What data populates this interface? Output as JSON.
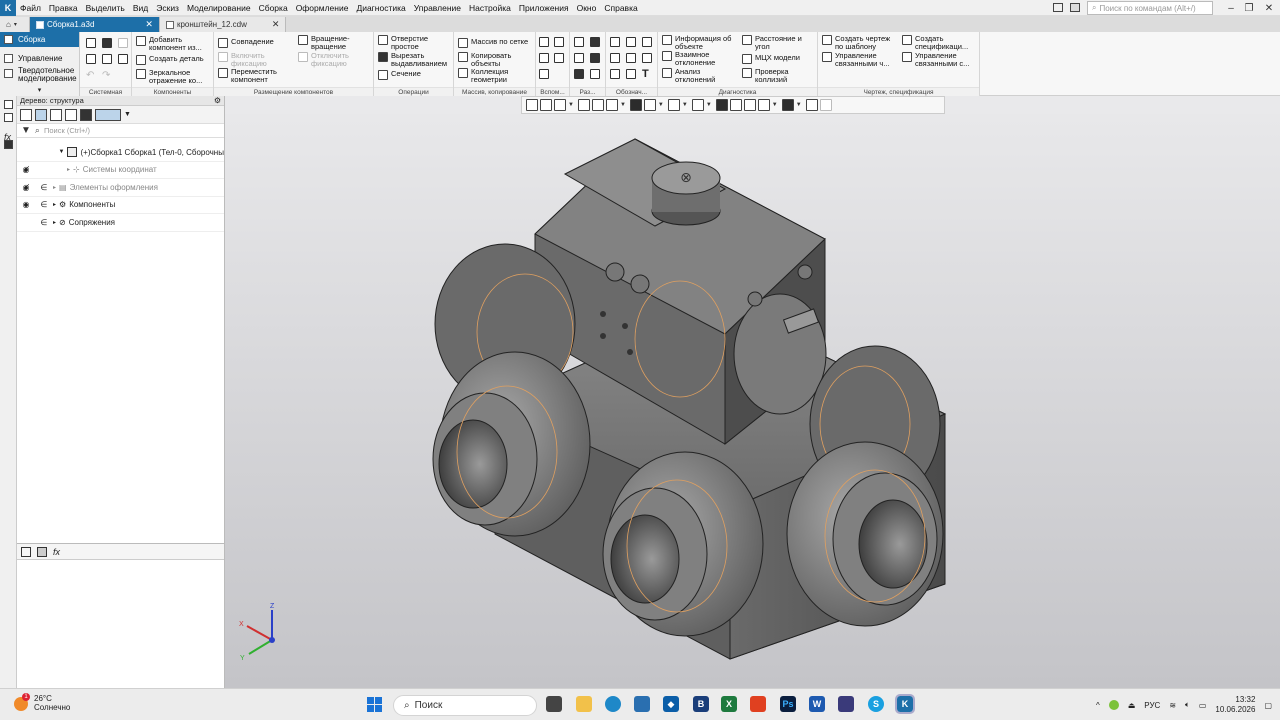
{
  "menubar": {
    "items": [
      "Файл",
      "Правка",
      "Выделить",
      "Вид",
      "Эскиз",
      "Моделирование",
      "Сборка",
      "Оформление",
      "Диагностика",
      "Управление",
      "Настройка",
      "Приложения",
      "Окно",
      "Справка"
    ],
    "search_placeholder": "Поиск по командам (Alt+/)"
  },
  "tabs": [
    {
      "label": "Сборка1.a3d",
      "active": true
    },
    {
      "label": "кронштейн_12.cdw",
      "active": false
    }
  ],
  "leftnav": {
    "items": [
      "Сборка",
      "Управление",
      "Твердотельное моделирование"
    ]
  },
  "ribbon": {
    "groups": [
      "Системная",
      "Компоненты",
      "Размещение компонентов",
      "Операции",
      "Массив, копирование",
      "Вспом...",
      "Раз...",
      "Обознач...",
      "Диагностика",
      "Чертеж, спецификация"
    ],
    "components": {
      "add": "Добавить компонент из...",
      "create_part": "Создать деталь",
      "mirror": "Зеркальное отражение ко..."
    },
    "placement": {
      "coincide": "Совпадение",
      "enable_fix": "Включить фиксацию",
      "move": "Переместить компонент",
      "rotate": "Вращение-вращение",
      "disable_fix": "Отключить фиксацию"
    },
    "operations": {
      "hole": "Отверстие простое",
      "cut": "Вырезать выдавливанием",
      "section": "Сечение"
    },
    "array": {
      "grid": "Массив по сетке",
      "copy": "Копировать объекты",
      "collection": "Коллекция геометрии"
    },
    "diagnostics": {
      "info": "Информация об объекте",
      "deviation": "Взаимное отклонение",
      "analysis": "Анализ отклонений",
      "distance": "Расстояние и угол",
      "mass": "МЦХ модели",
      "collision": "Проверка коллизий"
    },
    "drawing": {
      "create_drawing": "Создать чертеж по шаблону",
      "manage_linked": "Управление связанными ч...",
      "create_spec": "Создать спецификаци...",
      "manage_spec": "Управление связанными с..."
    }
  },
  "tree": {
    "header": "Дерево: структура",
    "search_placeholder": "Поиск (Ctrl+/)",
    "root": "(+)Сборка1 Сборка1 (Тел-0, Сборочны",
    "items": [
      "Системы координат",
      "Элементы оформления",
      "Компоненты",
      "Сопряжения"
    ]
  },
  "axes": {
    "x": "X",
    "y": "Y",
    "z": "Z"
  },
  "taskbar": {
    "weather_temp": "26°C",
    "weather_desc": "Солнечно",
    "weather_badge": "1",
    "search": "Поиск",
    "lang": "РУС",
    "time": "13:32",
    "date": "10.06.2026"
  }
}
